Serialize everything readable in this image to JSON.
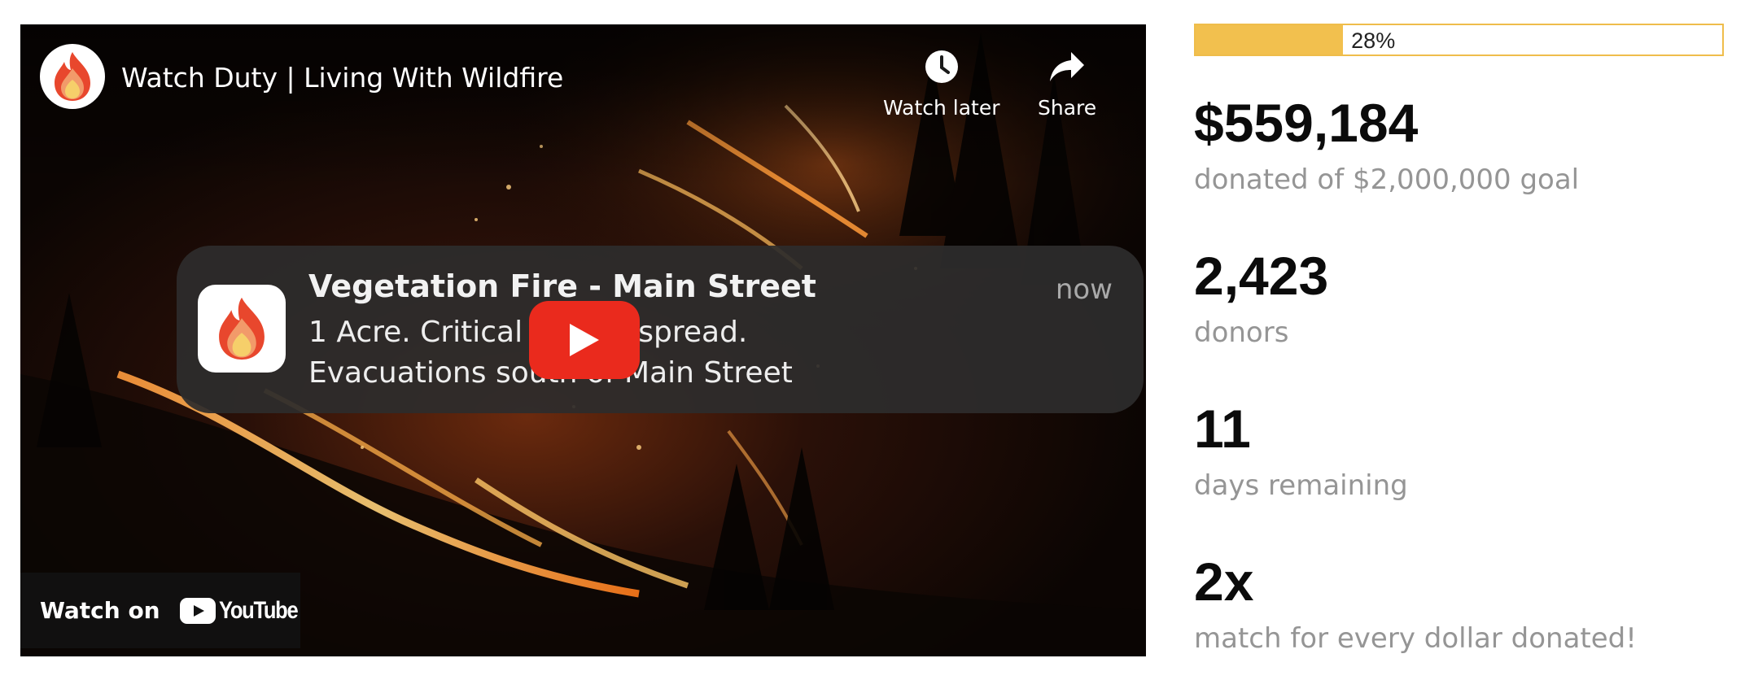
{
  "video": {
    "title": "Watch Duty | Living With Wildfire",
    "channel_icon": "watch-duty-flame-logo",
    "actions": {
      "watch_later_label": "Watch later",
      "share_label": "Share"
    },
    "notification": {
      "title": "Vegetation Fire - Main Street",
      "time": "now",
      "body_lines": [
        "1 Acre. Critical rate of spread.",
        "Evacuations south of Main Street"
      ]
    },
    "watch_on_label": "Watch on",
    "youtube_wordmark": "YouTube"
  },
  "campaign": {
    "progress_percent": 28,
    "progress_label": "28%",
    "stats": [
      {
        "value": "$559,184",
        "label": "donated of $2,000,000 goal"
      },
      {
        "value": "2,423",
        "label": "donors"
      },
      {
        "value": "11",
        "label": "days remaining"
      },
      {
        "value": "2x",
        "label": "match for every dollar donated!"
      }
    ]
  },
  "colors": {
    "progress_fill": "#f2c04e",
    "progress_border": "#efbd4b",
    "play_button": "#ea2a1d",
    "stat_value": "#0b0b0b",
    "stat_label": "#959595"
  }
}
